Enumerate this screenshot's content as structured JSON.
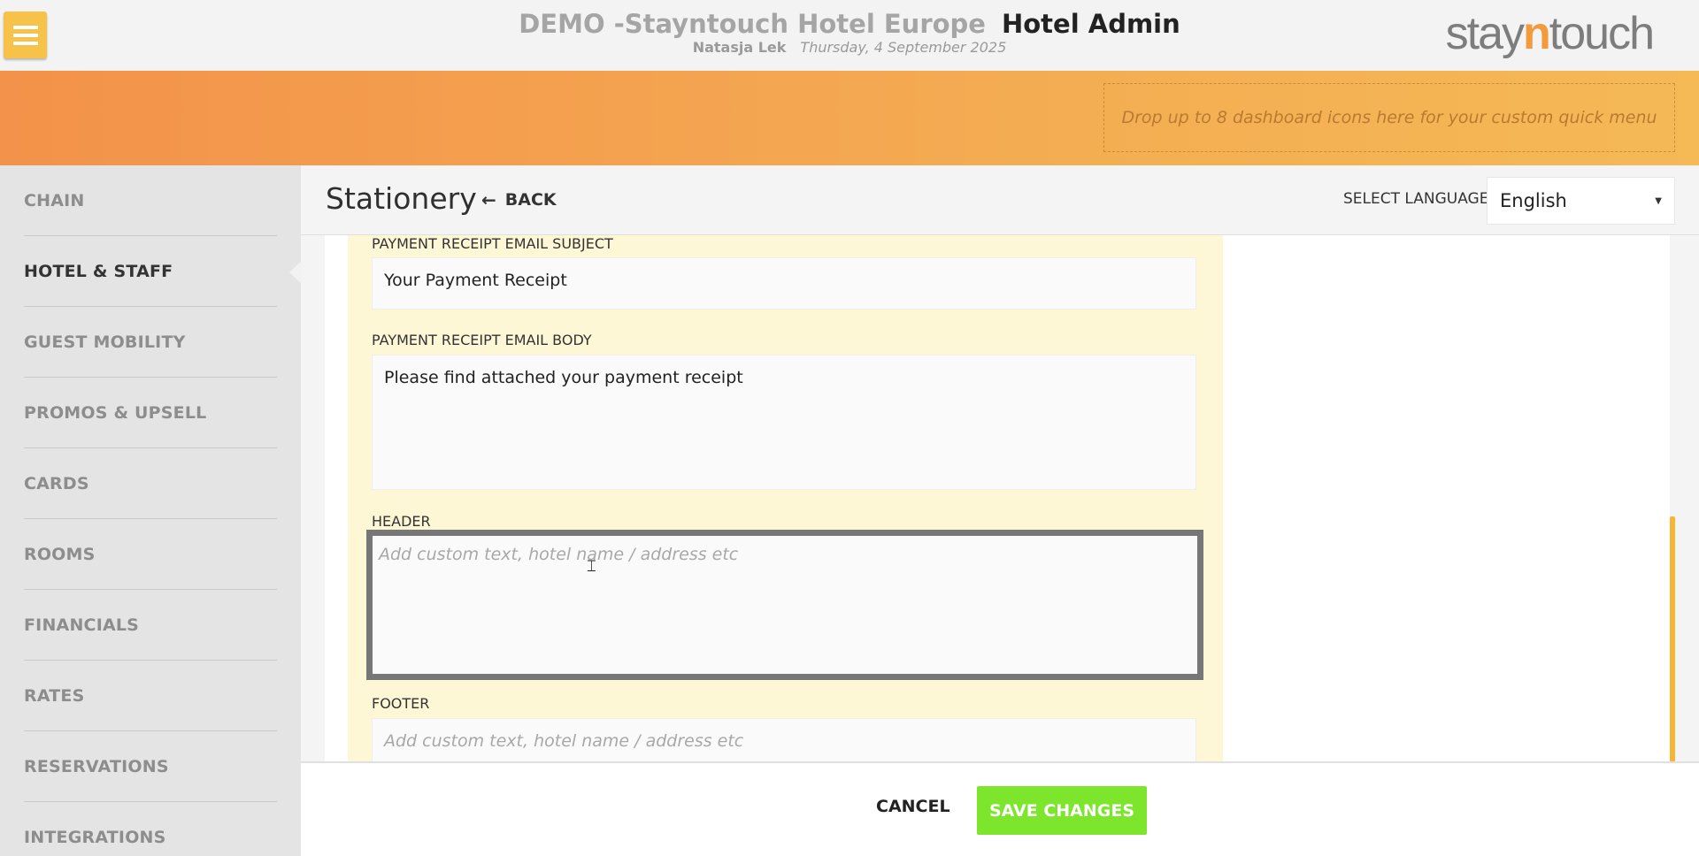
{
  "header": {
    "hotel_name": "DEMO -Stayntouch Hotel Europe",
    "app_name": "Hotel Admin",
    "user_name": "Natasja Lek",
    "date": "Thursday, 4 September 2025",
    "logo_prefix": "stay",
    "logo_highlight": "n",
    "logo_suffix": "touch",
    "menu_icon": "hamburger-menu-icon"
  },
  "banner": {
    "quick_menu_hint": "Drop up to 8 dashboard icons here for your custom quick menu"
  },
  "sidebar": {
    "items": [
      {
        "label": "CHAIN"
      },
      {
        "label": "HOTEL & STAFF",
        "active": true
      },
      {
        "label": "GUEST MOBILITY"
      },
      {
        "label": "PROMOS & UPSELL"
      },
      {
        "label": "CARDS"
      },
      {
        "label": "ROOMS"
      },
      {
        "label": "FINANCIALS"
      },
      {
        "label": "RATES"
      },
      {
        "label": "RESERVATIONS"
      },
      {
        "label": "INTEGRATIONS"
      }
    ]
  },
  "page": {
    "title": "Stationery",
    "back_label": "BACK",
    "back_icon": "arrow-left-icon",
    "select_language_label": "SELECT LANGUAGE",
    "language_value": "English"
  },
  "form": {
    "payment_receipt_subject_label": "PAYMENT RECEIPT EMAIL SUBJECT",
    "payment_receipt_subject_value": "Your Payment Receipt",
    "payment_receipt_body_label": "PAYMENT RECEIPT EMAIL BODY",
    "payment_receipt_body_value": "Please find attached your payment receipt",
    "header_label": "HEADER",
    "header_placeholder": "Add custom text, hotel name / address etc",
    "footer_label": "FOOTER",
    "footer_placeholder": "Add custom text, hotel name / address etc"
  },
  "actions": {
    "cancel_label": "CANCEL",
    "save_label": "SAVE CHANGES"
  },
  "colors": {
    "accent_orange": "#f3924a",
    "menu_button": "#f6c24a",
    "save_green": "#7ce52c",
    "form_panel": "#fdf7d6"
  }
}
